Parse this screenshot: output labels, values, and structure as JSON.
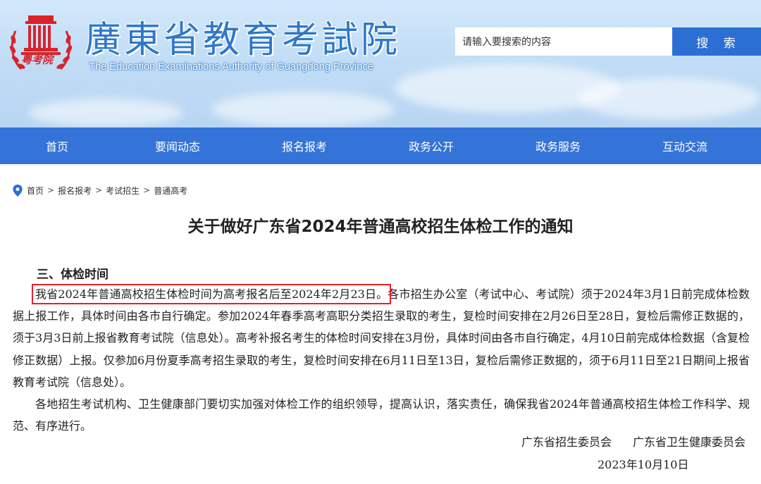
{
  "header": {
    "site_title": "廣東省教育考試院",
    "site_subtitle": "The Education Examinations Authority of Guangdong Province",
    "logo_text": "粤考院",
    "search_placeholder": "请输入要搜索的内容",
    "search_button": "搜 索"
  },
  "nav": {
    "items": [
      {
        "label": "首页"
      },
      {
        "label": "要闻动态"
      },
      {
        "label": "报名报考"
      },
      {
        "label": "政务公开"
      },
      {
        "label": "政务服务"
      },
      {
        "label": "互动交流"
      }
    ]
  },
  "breadcrumb": {
    "items": [
      "首页",
      "报名报考",
      "考试招生",
      "普通高考"
    ],
    "separator": ">"
  },
  "article": {
    "title": "关于做好广东省2024年普通高校招生体检工作的通知",
    "section_heading": "三、体检时间",
    "highlighted_sentence": "我省2024年普通高校招生体检时间为高考报名后至2024年2月23日。",
    "paragraph1_rest": "各市招生办公室（考试中心、考试院）须于2024年3月1日前完成体检数据上报工作，具体时间由各市自行确定。参加2024年春季高考高职分类招生录取的考生，复检时间安排在2月26日至28日，复检后需修正数据的，须于3月3日前上报省教育考试院（信息处）。高考补报名考生的体检时间安排在3月份，具体时间由各市自行确定，4月10日前完成体检数据（含复检修正数据）上报。仅参加6月份夏季高考招生录取的考生，复检时间安排在6月11日至13日，复检后需修正数据的，须于6月11日至21日期间上报省教育考试院（信息处）。",
    "paragraph2": "各地招生考试机构、卫生健康部门要切实加强对体检工作的组织领导，提高认识，落实责任，确保我省2024年普通高校招生体检工作科学、规范、有序进行。",
    "signers": [
      "广东省招生委员会",
      "广东省卫生健康委员会"
    ],
    "date": "2023年10月10日"
  },
  "colors": {
    "nav_bg": "#3473d8",
    "search_button_bg": "#2b6fd2",
    "title_blue": "#2f78c9",
    "logo_red": "#d8232a",
    "highlight_border": "#e8202a"
  }
}
